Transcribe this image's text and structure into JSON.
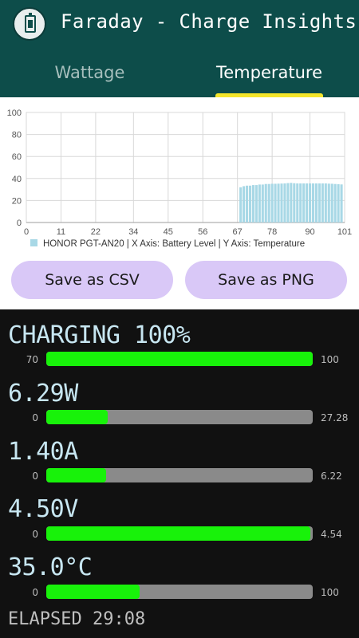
{
  "app": {
    "title": "Faraday - Charge Insights",
    "icon": "battery-charging-icon"
  },
  "tabs": [
    {
      "label": "Wattage",
      "selected": false
    },
    {
      "label": "Temperature",
      "selected": true
    }
  ],
  "colors": {
    "appbar": "#0d4d4a",
    "indicator": "#f5e62b",
    "bar": "#a8d8e6",
    "gauge_fill": "#18f20a",
    "gauge_track": "#8a8a8a",
    "metric_text": "#c7e6f1",
    "button": "#d9c8f7"
  },
  "chart_data": {
    "type": "bar",
    "xlabel": "",
    "ylabel": "",
    "ylim": [
      0,
      100
    ],
    "xlim": [
      0,
      101
    ],
    "y_ticks": [
      "100",
      "80",
      "60",
      "40",
      "20",
      "0"
    ],
    "x_ticks": [
      "0",
      "11",
      "22",
      "34",
      "45",
      "56",
      "67",
      "78",
      "90",
      "101"
    ],
    "grid": true,
    "legend": "bottom-left",
    "legend_label": "HONOR PGT-AN20 | X Axis: Battery Level | Y Axis: Temperature",
    "x": [
      68,
      69,
      70,
      71,
      72,
      73,
      74,
      75,
      76,
      77,
      78,
      79,
      80,
      81,
      82,
      83,
      84,
      85,
      86,
      87,
      88,
      89,
      90,
      91,
      92,
      93,
      94,
      95,
      96,
      97,
      98,
      99,
      100
    ],
    "values": [
      32,
      33,
      33.5,
      33.5,
      34,
      34,
      34.5,
      34.5,
      35,
      35,
      35.2,
      35.2,
      35.3,
      35.4,
      35.5,
      35.8,
      36,
      35.7,
      35.5,
      35.5,
      35.5,
      35.5,
      35.5,
      35.5,
      35.5,
      35.5,
      35.5,
      35.5,
      35.3,
      35.2,
      35,
      34.8,
      34.6
    ]
  },
  "actions": {
    "csv_label": "Save as CSV",
    "png_label": "Save as PNG"
  },
  "metrics": [
    {
      "id": "status",
      "label": "CHARGING 100%",
      "min": "70",
      "max": "100",
      "fill": 1.0
    },
    {
      "id": "power",
      "label": "6.29W",
      "min": "0",
      "max": "27.28",
      "fill": 0.23
    },
    {
      "id": "current",
      "label": "1.40A",
      "min": "0",
      "max": "6.22",
      "fill": 0.225
    },
    {
      "id": "voltage",
      "label": "4.50V",
      "min": "0",
      "max": "4.54",
      "fill": 0.99
    },
    {
      "id": "temperature",
      "label": "35.0°C",
      "min": "0",
      "max": "100",
      "fill": 0.35
    }
  ],
  "elapsed": "ELAPSED 29:08"
}
